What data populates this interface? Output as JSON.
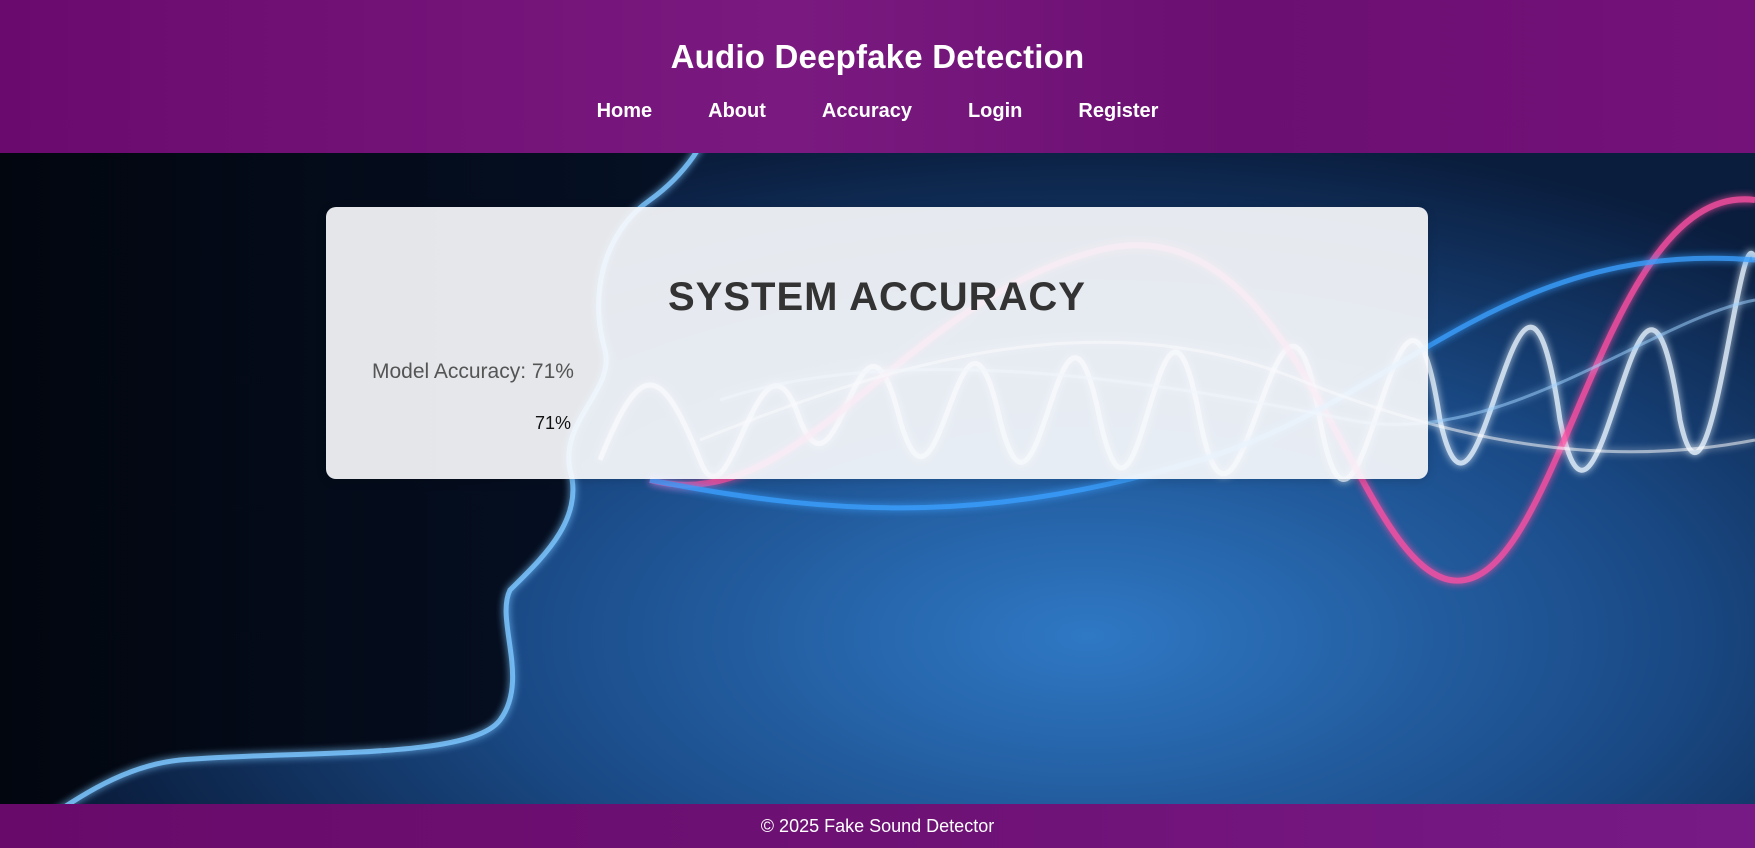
{
  "header": {
    "title": "Audio Deepfake Detection",
    "nav": [
      {
        "label": "Home"
      },
      {
        "label": "About"
      },
      {
        "label": "Accuracy"
      },
      {
        "label": "Login"
      },
      {
        "label": "Register"
      }
    ]
  },
  "card": {
    "title": "SYSTEM ACCURACY",
    "accuracy_label": "Model Accuracy: 71%",
    "progress": {
      "value": 0.71,
      "text": "71%"
    }
  },
  "footer": {
    "text": "© 2025 Fake Sound Detector"
  },
  "colors": {
    "header_bg": "#6e0e74",
    "footer_bg": "#6e1175",
    "card_bg": "#f8fafc",
    "title_text": "#333333",
    "wave_pink": "#ff4fa3",
    "wave_blue": "#3aa0ff"
  }
}
